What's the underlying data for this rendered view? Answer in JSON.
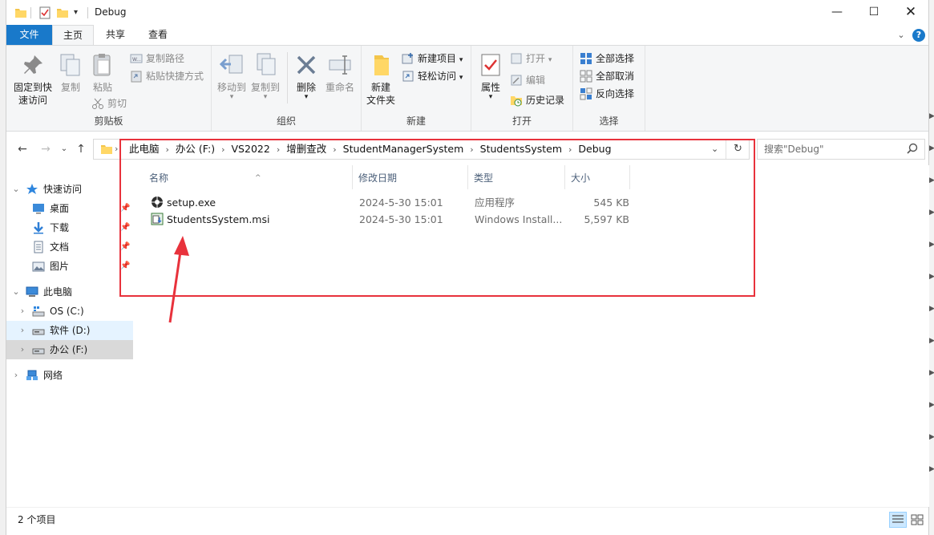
{
  "window": {
    "title": "Debug"
  },
  "tabs": {
    "file": "文件",
    "home": "主页",
    "share": "共享",
    "view": "查看"
  },
  "ribbon": {
    "clipboard": {
      "pin_quick_access_line1": "固定到快",
      "pin_quick_access_line2": "速访问",
      "copy": "复制",
      "paste": "粘贴",
      "copy_path": "复制路径",
      "paste_shortcut": "粘贴快捷方式",
      "cut": "剪切",
      "label": "剪贴板"
    },
    "organize": {
      "move_to": "移动到",
      "copy_to": "复制到",
      "delete": "删除",
      "rename": "重命名",
      "label": "组织"
    },
    "new": {
      "new_folder_line1": "新建",
      "new_folder_line2": "文件夹",
      "new_item": "新建项目",
      "easy_access": "轻松访问",
      "label": "新建"
    },
    "open": {
      "properties": "属性",
      "open": "打开",
      "edit": "编辑",
      "history": "历史记录",
      "label": "打开"
    },
    "select": {
      "select_all": "全部选择",
      "select_none": "全部取消",
      "invert_selection": "反向选择",
      "label": "选择"
    }
  },
  "address": {
    "crumbs": [
      "此电脑",
      "办公 (F:)",
      "VS2022",
      "增删查改",
      "StudentManagerSystem",
      "StudentsSystem",
      "Debug"
    ],
    "search_placeholder": "搜索\"Debug\""
  },
  "nav": {
    "quick_access": "快速访问",
    "desktop": "桌面",
    "downloads": "下载",
    "documents": "文档",
    "pictures": "图片",
    "this_pc": "此电脑",
    "drive_c": "OS (C:)",
    "drive_d": "软件 (D:)",
    "drive_f": "办公 (F:)",
    "network": "网络"
  },
  "columns": {
    "name": "名称",
    "modified": "修改日期",
    "type": "类型",
    "size": "大小"
  },
  "files": [
    {
      "name": "setup.exe",
      "modified": "2024-5-30 15:01",
      "type": "应用程序",
      "size": "545 KB"
    },
    {
      "name": "StudentsSystem.msi",
      "modified": "2024-5-30 15:01",
      "type": "Windows Install...",
      "size": "5,597 KB"
    }
  ],
  "status": {
    "item_count": "2 个项目"
  },
  "colors": {
    "accent": "#1979ca",
    "annotation": "#e8323c",
    "selection": "#cce8ff"
  }
}
